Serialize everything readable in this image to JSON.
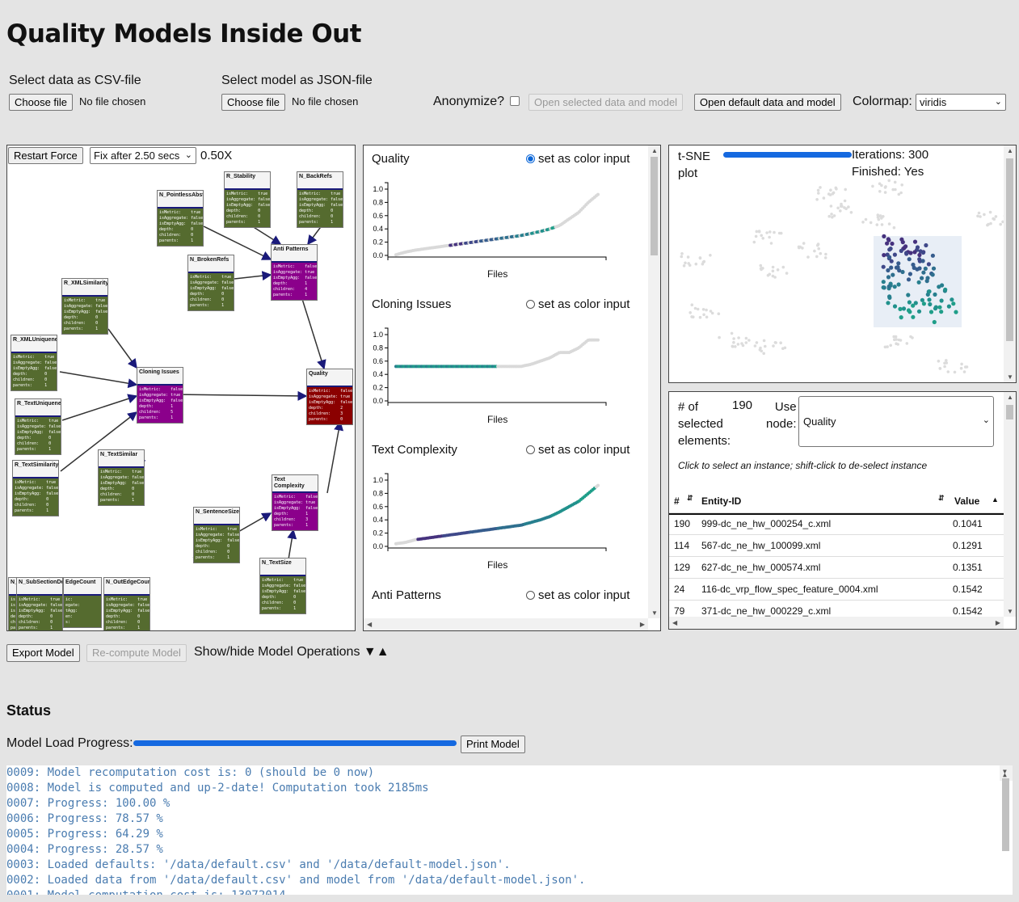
{
  "title": "Quality Models Inside Out",
  "controls": {
    "csv_label": "Select data as CSV-file",
    "json_label": "Select model as JSON-file",
    "choose_file": "Choose file",
    "no_file": "No file chosen",
    "anonymize_label": "Anonymize?",
    "open_selected": "Open selected data and model",
    "open_default": "Open default data and model",
    "colormap_label": "Colormap:",
    "colormap_value": "viridis"
  },
  "graph": {
    "restart_force": "Restart Force",
    "fix_after": "Fix after 2.50 secs",
    "zoom": "0.50X",
    "nodes": [
      {
        "id": "pointless",
        "name": "N_PointlessAbstraction",
        "color": "green"
      },
      {
        "id": "stability",
        "name": "R_Stability",
        "color": "green"
      },
      {
        "id": "backrefs",
        "name": "N_BackRefs",
        "color": "green"
      },
      {
        "id": "brokenrefs",
        "name": "N_BrokenRefs",
        "color": "green"
      },
      {
        "id": "antipatterns",
        "name": "Anti Patterns",
        "color": "magenta"
      },
      {
        "id": "xmlsimilarity",
        "name": "R_XMLSimilarity",
        "color": "green"
      },
      {
        "id": "xmluniqueness",
        "name": "R_XMLUniqueness",
        "color": "green"
      },
      {
        "id": "cloning",
        "name": "Cloning Issues",
        "color": "magenta"
      },
      {
        "id": "quality",
        "name": "Quality",
        "color": "red"
      },
      {
        "id": "textuniqueness",
        "name": "R_TextUniqueness",
        "color": "green"
      },
      {
        "id": "textsimilarity",
        "name": "R_TextSimilarity",
        "color": "green"
      },
      {
        "id": "textsimilar",
        "name": "N_TextSimilar",
        "color": "green"
      },
      {
        "id": "textcomplexity",
        "name": "Text Complexity",
        "color": "magenta"
      },
      {
        "id": "sentencesize",
        "name": "N_SentenceSize",
        "color": "green"
      },
      {
        "id": "textsize",
        "name": "N_TextSize",
        "color": "green"
      },
      {
        "id": "n1",
        "name": "N_",
        "color": "green"
      },
      {
        "id": "subsection",
        "name": "N_SubSectionDepth",
        "color": "green"
      },
      {
        "id": "edgecount",
        "name": "EdgeCount",
        "color": "green"
      },
      {
        "id": "outedge",
        "name": "N_OutEdgeCount",
        "color": "green"
      }
    ]
  },
  "charts_panel": {
    "charts": [
      {
        "title": "Quality",
        "radio": "set as color input",
        "selected": true,
        "xlabel": "Files"
      },
      {
        "title": "Cloning Issues",
        "radio": "set as color input",
        "selected": false,
        "xlabel": "Files"
      },
      {
        "title": "Text Complexity",
        "radio": "set as color input",
        "selected": false,
        "xlabel": "Files"
      },
      {
        "title": "Anti Patterns",
        "radio": "set as color input",
        "selected": false,
        "xlabel": ""
      }
    ],
    "yticks": [
      "1.0",
      "0.8",
      "0.6",
      "0.4",
      "0.2",
      "0.0"
    ]
  },
  "chart_data": [
    {
      "type": "scatter",
      "title": "Quality",
      "xlabel": "Files",
      "ylim": [
        0,
        1
      ],
      "y_sorted_profile": [
        0.01,
        0.05,
        0.08,
        0.1,
        0.12,
        0.14,
        0.16,
        0.18,
        0.2,
        0.22,
        0.24,
        0.26,
        0.28,
        0.3,
        0.33,
        0.36,
        0.4,
        0.45,
        0.55,
        0.65,
        0.8,
        0.92
      ]
    },
    {
      "type": "scatter",
      "title": "Cloning Issues",
      "xlabel": "Files",
      "ylim": [
        0,
        1
      ],
      "y_sorted_profile": [
        0.52,
        0.52,
        0.52,
        0.52,
        0.52,
        0.52,
        0.52,
        0.52,
        0.52,
        0.52,
        0.52,
        0.52,
        0.52,
        0.52,
        0.55,
        0.6,
        0.65,
        0.73,
        0.73,
        0.8,
        0.92,
        0.92
      ]
    },
    {
      "type": "scatter",
      "title": "Text Complexity",
      "xlabel": "Files",
      "ylim": [
        0,
        1
      ],
      "y_sorted_profile": [
        0.04,
        0.06,
        0.1,
        0.12,
        0.14,
        0.16,
        0.18,
        0.2,
        0.22,
        0.24,
        0.26,
        0.28,
        0.3,
        0.32,
        0.36,
        0.4,
        0.45,
        0.52,
        0.6,
        0.68,
        0.8,
        0.92
      ]
    }
  ],
  "tsne": {
    "title_line1": "t-SNE",
    "title_line2": "plot",
    "iterations": "Iterations: 300",
    "finished": "Finished: Yes",
    "progress": 1.0
  },
  "selection": {
    "count_label_1": "# of",
    "count_label_2": "selected",
    "count_label_3": "elements:",
    "count": "190",
    "use_label_1": "Use",
    "use_label_2": "node:",
    "node_value": "Quality",
    "hint": "Click to select an instance; shift-click to de-select instance",
    "columns": [
      "#",
      "Entity-ID",
      "Value"
    ],
    "rows": [
      {
        "n": "190",
        "id": "999-dc_ne_hw_000254_c.xml",
        "value": "0.1041"
      },
      {
        "n": "114",
        "id": "567-dc_ne_hw_100099.xml",
        "value": "0.1291"
      },
      {
        "n": "129",
        "id": "627-dc_ne_hw_000574.xml",
        "value": "0.1351"
      },
      {
        "n": "24",
        "id": "116-dc_vrp_flow_spec_feature_0004.xml",
        "value": "0.1542"
      },
      {
        "n": "79",
        "id": "371-dc_ne_hw_000229_c.xml",
        "value": "0.1542"
      }
    ]
  },
  "bottom": {
    "export_model": "Export Model",
    "recompute_model": "Re-compute Model",
    "show_hide": "Show/hide Model Operations",
    "show_hide_arrows": "▼▲"
  },
  "status": {
    "heading": "Status",
    "load_progress_label": "Model Load Progress:",
    "load_progress": 1.0,
    "print_model": "Print Model",
    "log": [
      "0009: Model recomputation cost is: 0 (should be 0 now)",
      "0008: Model is computed and up-2-date! Computation took 2185ms",
      "0007: Progress: 100.00 %",
      "0006: Progress: 78.57 %",
      "0005: Progress: 64.29 %",
      "0004: Progress: 28.57 %",
      "0003: Loaded defaults: '/data/default.csv' and '/data/default-model.json'.",
      "0002: Loaded data from '/data/default.csv' and model from '/data/default-model.json'.",
      "0001: Model computation cost is: 13072014"
    ]
  },
  "colors": {
    "accent": "#1569e0",
    "viridis_dark": "#46327e",
    "viridis_mid": "#277f8e",
    "viridis_teal": "#1f9e89",
    "node_green": "#556b2f",
    "node_magenta": "#8b008b",
    "node_red": "#8b0000"
  }
}
